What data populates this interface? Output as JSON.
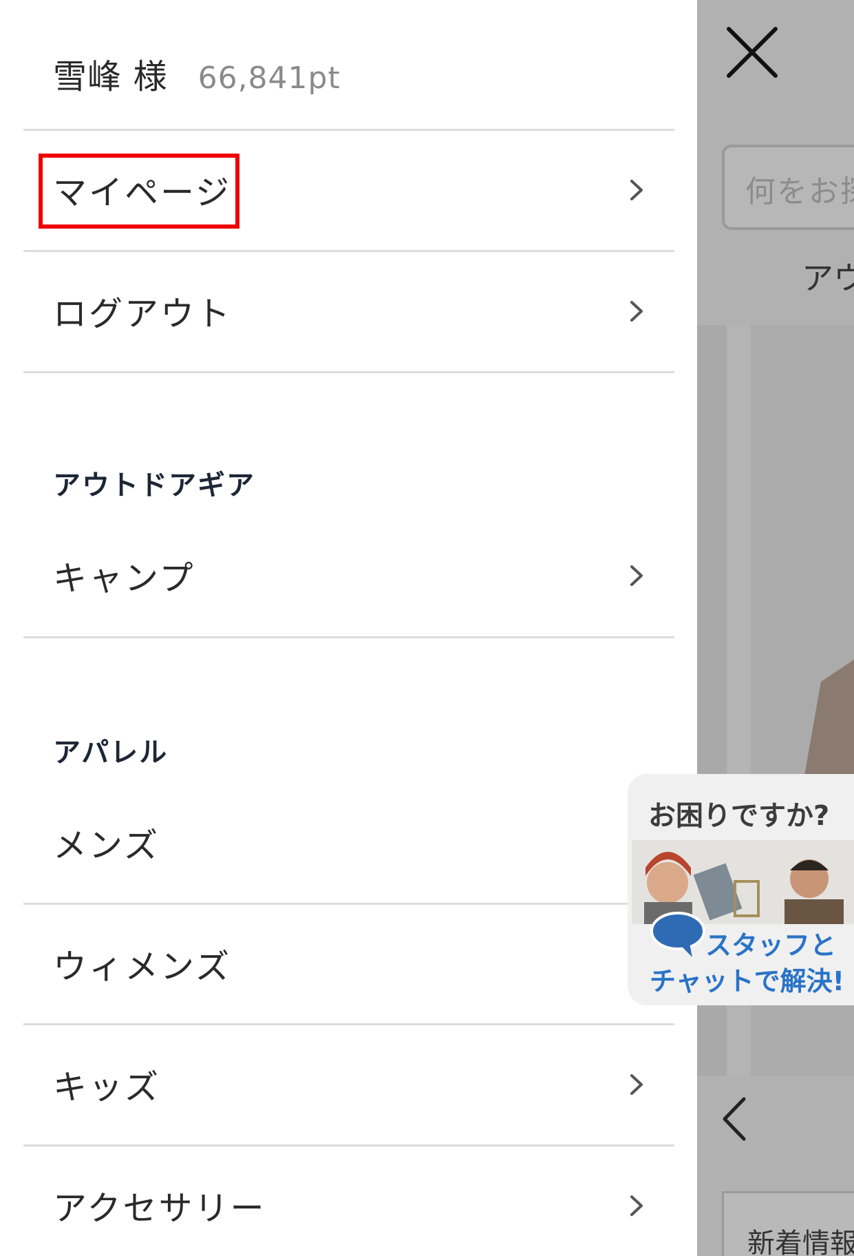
{
  "user": {
    "name": "雪峰 様",
    "points": "66,841pt"
  },
  "menu": {
    "top_items": [
      {
        "label": "マイページ",
        "has_chevron": true,
        "highlighted": true
      },
      {
        "label": "ログアウト",
        "has_chevron": true
      }
    ],
    "sections": [
      {
        "heading": "アウトドアギア",
        "items": [
          {
            "label": "キャンプ",
            "has_chevron": true
          }
        ]
      },
      {
        "heading": "アパレル",
        "items": [
          {
            "label": "メンズ",
            "has_chevron": false
          },
          {
            "label": "ウィメンズ",
            "has_chevron": false
          },
          {
            "label": "キッズ",
            "has_chevron": true
          },
          {
            "label": "アクセサリー",
            "has_chevron": true
          }
        ]
      }
    ]
  },
  "background_page": {
    "search_placeholder": "何をお探",
    "tab_label": "アウ",
    "bottom_label": "新着情報"
  },
  "chat_widget": {
    "title": "お困りですか?",
    "line1": "スタッフと",
    "line2": "チャットで解決!"
  },
  "colors": {
    "highlight": "#ee0000",
    "chat_accent": "#2a73c7",
    "section_heading": "#1e2636"
  },
  "icons": {
    "close": "close-icon",
    "chevron": "chevron-right-icon",
    "prev": "chevron-left-icon",
    "chat": "chat-bubble-icon"
  }
}
